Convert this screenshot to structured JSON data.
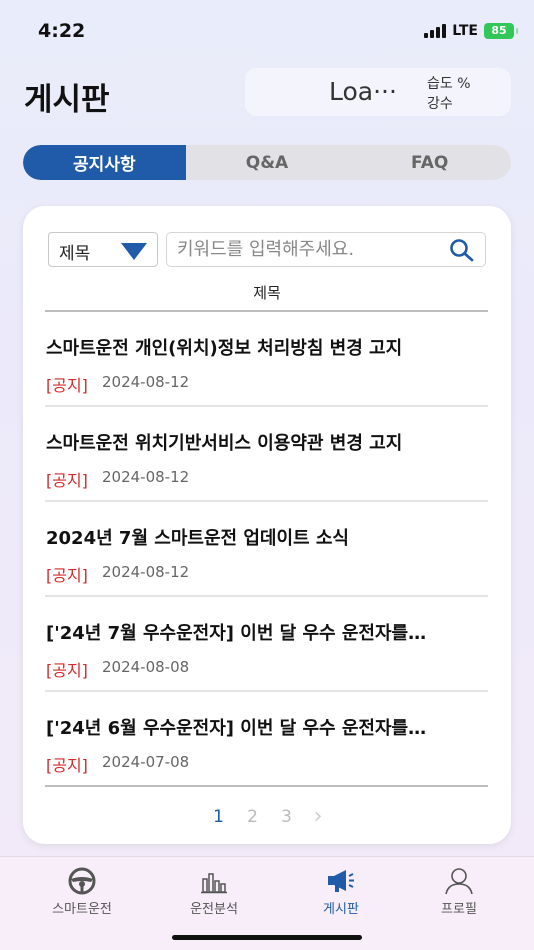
{
  "status_bar": {
    "time": "4:22",
    "network": "LTE",
    "battery": "85"
  },
  "header": {
    "title": "게시판",
    "weather": {
      "loading_text": "Loa···",
      "humidity_label": "습도 %",
      "rain_label": "강수"
    }
  },
  "tabs": [
    {
      "label": "공지사항",
      "active": true
    },
    {
      "label": "Q&A",
      "active": false
    },
    {
      "label": "FAQ",
      "active": false
    }
  ],
  "search": {
    "filter_value": "제목",
    "placeholder": "키워드를 입력해주세요."
  },
  "list": {
    "column_header": "제목",
    "posts": [
      {
        "title": "스마트운전 개인(위치)정보 처리방침 변경 고지",
        "tag": "[공지]",
        "date": "2024-08-12"
      },
      {
        "title": "스마트운전 위치기반서비스 이용약관 변경 고지",
        "tag": "[공지]",
        "date": "2024-08-12"
      },
      {
        "title": "2024년 7월 스마트운전 업데이트 소식",
        "tag": "[공지]",
        "date": "2024-08-12"
      },
      {
        "title": "['24년 7월 우수운전자] 이번 달 우수 운전자를…",
        "tag": "[공지]",
        "date": "2024-08-08"
      },
      {
        "title": "['24년 6월 우수운전자] 이번 달 우수 운전자를…",
        "tag": "[공지]",
        "date": "2024-07-08"
      }
    ]
  },
  "pagination": {
    "pages": [
      "1",
      "2",
      "3"
    ],
    "current": "1",
    "next": "›"
  },
  "bottom_nav": [
    {
      "label": "스마트운전",
      "icon": "steering-wheel-icon",
      "active": false
    },
    {
      "label": "운전분석",
      "icon": "bar-chart-icon",
      "active": false
    },
    {
      "label": "게시판",
      "icon": "megaphone-icon",
      "active": true
    },
    {
      "label": "프로필",
      "icon": "person-icon",
      "active": false
    }
  ],
  "colors": {
    "accent": "#1f5ba8",
    "tag_red": "#d52b2b",
    "battery_green": "#33c759"
  }
}
